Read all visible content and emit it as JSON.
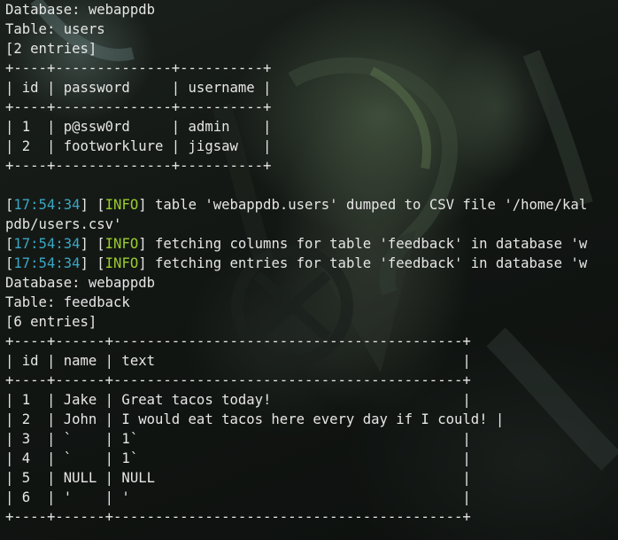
{
  "colors": {
    "text": "#e6e6e6",
    "timestamp": "#3aa7c4",
    "info_tag": "#9ccc2e",
    "background": "#0c0f0d"
  },
  "terminal": {
    "block1": {
      "database_line": "Database: webappdb",
      "table_line": "Table: users",
      "entries_line": "[2 entries]",
      "border": "+----+--------------+----------+",
      "header": "| id | password     | username |",
      "rows": [
        "| 1  | p@ssw0rd     | admin    |",
        "| 2  | footworklure | jigsaw   |"
      ]
    },
    "logs": [
      {
        "open": "[",
        "time": "17:54:34",
        "mid": "] [",
        "level": "INFO",
        "close": "]",
        "message": " table 'webappdb.users' dumped to CSV file '/home/kal"
      },
      {
        "continuation": "pdb/users.csv'"
      },
      {
        "open": "[",
        "time": "17:54:34",
        "mid": "] [",
        "level": "INFO",
        "close": "]",
        "message": " fetching columns for table 'feedback' in database 'w"
      },
      {
        "open": "[",
        "time": "17:54:34",
        "mid": "] [",
        "level": "INFO",
        "close": "]",
        "message": " fetching entries for table 'feedback' in database 'w"
      }
    ],
    "block2": {
      "database_line": "Database: webappdb",
      "table_line": "Table: feedback",
      "entries_line": "[6 entries]",
      "border": "+----+------+------------------------------------------+",
      "header": "| id | name | text                                     |",
      "rows": [
        "| 1  | Jake | Great tacos today!                       |",
        "| 2  | John | I would eat tacos here every day if I could! |",
        "| 3  | `    | 1`                                       |",
        "| 4  | `    | 1`                                       |",
        "| 5  | NULL | NULL                                     |",
        "| 6  | '    | '                                        |"
      ]
    }
  }
}
